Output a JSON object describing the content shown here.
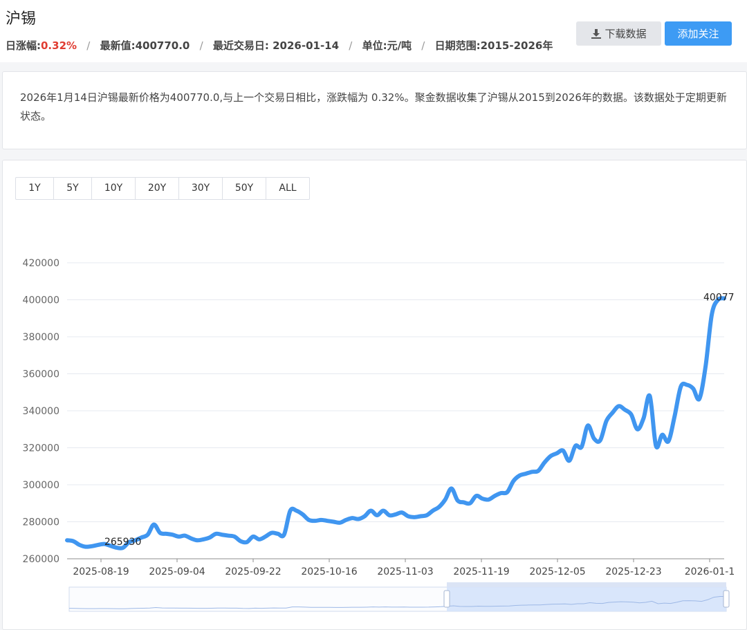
{
  "header": {
    "title": "沪锡",
    "change_label": "日涨幅:",
    "change_value": "0.32%",
    "latest_label": "最新值:400770.0",
    "date_label": "最近交易日: 2026-01-14",
    "unit_label": "单位:元/吨",
    "range_label": "日期范围:2015-2026年",
    "separator": "/",
    "download_label": "下载数据",
    "follow_label": "添加关注",
    "download_icon": "download-icon"
  },
  "description": "2026年1月14日沪锡最新价格为400770.0,与上一个交易日相比，涨跌幅为 0.32%。聚金数据收集了沪锡从2015到2026年的数据。该数据处于定期更新状态。",
  "range_buttons": [
    "1Y",
    "5Y",
    "10Y",
    "20Y",
    "30Y",
    "50Y",
    "ALL"
  ],
  "colors": {
    "line": "#4096f0",
    "follow_button": "#3d9bf4",
    "change_red": "#e03c31"
  },
  "chart_data": {
    "type": "line",
    "title": "",
    "xlabel": "",
    "ylabel": "",
    "ylim": [
      260000,
      420000
    ],
    "yticks": [
      "260000",
      "280000",
      "300000",
      "320000",
      "340000",
      "360000",
      "380000",
      "400000",
      "420000"
    ],
    "xticks": [
      "2025-08-19",
      "2025-09-04",
      "2025-09-22",
      "2025-10-16",
      "2025-11-03",
      "2025-11-19",
      "2025-12-05",
      "2025-12-23",
      "2026-01-1"
    ],
    "grid": true,
    "min_label": "265930",
    "max_label": "40077",
    "series": [
      {
        "name": "",
        "values": [
          270000,
          269500,
          267500,
          266500,
          266800,
          267500,
          268000,
          267000,
          266000,
          265930,
          269000,
          270000,
          271500,
          273000,
          278500,
          274000,
          273500,
          273000,
          272000,
          272500,
          271000,
          270000,
          270500,
          271500,
          273500,
          273000,
          272500,
          272000,
          269500,
          269000,
          272000,
          270500,
          272000,
          274000,
          273500,
          273000,
          286000,
          286000,
          284000,
          281000,
          280500,
          281000,
          280500,
          280000,
          279500,
          281000,
          282000,
          281500,
          283000,
          286000,
          283500,
          286000,
          283500,
          284000,
          285000,
          283000,
          282500,
          283000,
          283500,
          286000,
          288000,
          292000,
          298000,
          291500,
          290500,
          290000,
          294000,
          292500,
          292000,
          294000,
          295500,
          296000,
          302000,
          305000,
          306000,
          307000,
          307500,
          312000,
          315500,
          317000,
          318500,
          313000,
          321000,
          320500,
          332000,
          325000,
          324000,
          334500,
          339000,
          342500,
          340500,
          338000,
          330000,
          336000,
          348000,
          321000,
          327000,
          323500,
          337000,
          353000,
          354000,
          352000,
          346500,
          364000,
          392000,
          400000,
          400770
        ]
      }
    ]
  }
}
